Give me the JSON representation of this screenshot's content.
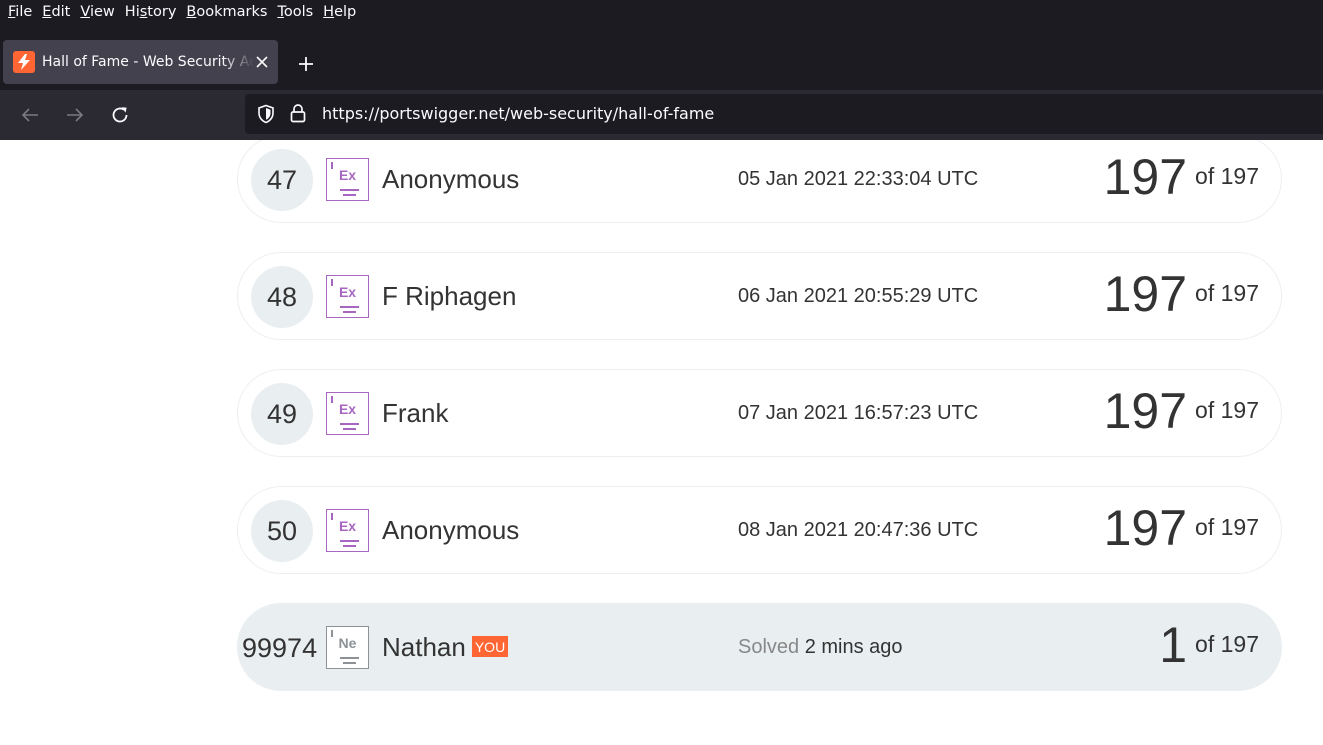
{
  "menubar": {
    "items": [
      {
        "access_key": "F",
        "rest": "ile"
      },
      {
        "access_key": "E",
        "rest": "dit"
      },
      {
        "access_key": "V",
        "rest": "iew"
      },
      {
        "pre": "Hi",
        "access_key": "s",
        "rest": "tory"
      },
      {
        "access_key": "B",
        "rest": "ookmarks"
      },
      {
        "access_key": "T",
        "rest": "ools"
      },
      {
        "access_key": "H",
        "rest": "elp"
      }
    ]
  },
  "tab": {
    "title": "Hall of Fame - Web Security Academy"
  },
  "navbar": {
    "url": "https://portswigger.net/web-security/hall-of-fame"
  },
  "leaderboard": {
    "total": "197",
    "of_label": "of",
    "rows": [
      {
        "rank": "47",
        "badge": "Ex",
        "name": "Anonymous",
        "date": "05 Jan 2021 22:33:04 UTC",
        "score": "197"
      },
      {
        "rank": "48",
        "badge": "Ex",
        "name": "F Riphagen",
        "date": "06 Jan 2021 20:55:29 UTC",
        "score": "197"
      },
      {
        "rank": "49",
        "badge": "Ex",
        "name": "Frank",
        "date": "07 Jan 2021 16:57:23 UTC",
        "score": "197"
      },
      {
        "rank": "50",
        "badge": "Ex",
        "name": "Anonymous",
        "date": "08 Jan 2021 20:47:36 UTC",
        "score": "197"
      }
    ],
    "you_row": {
      "rank": "99974",
      "badge": "Ne",
      "name": "Nathan",
      "you_label": "YOU",
      "solved_label": "Solved",
      "solved_when": "2 mins ago",
      "score": "1"
    }
  },
  "colors": {
    "chrome_dark": "#1c1b22",
    "toolbar": "#2b2a33",
    "tab_active": "#42414d",
    "accent_orange": "#ff6633",
    "badge_purple": "#a767c0",
    "badge_grey": "#8c9295",
    "rank_circle": "#e9eef0"
  },
  "icons": {
    "tab_favicon": "portswigger-lightning-icon",
    "tab_close": "close-icon",
    "new_tab": "plus-icon",
    "back": "arrow-left-icon",
    "forward": "arrow-right-icon",
    "reload": "reload-icon",
    "shield": "tracking-protection-shield-icon",
    "lock": "lock-icon"
  }
}
